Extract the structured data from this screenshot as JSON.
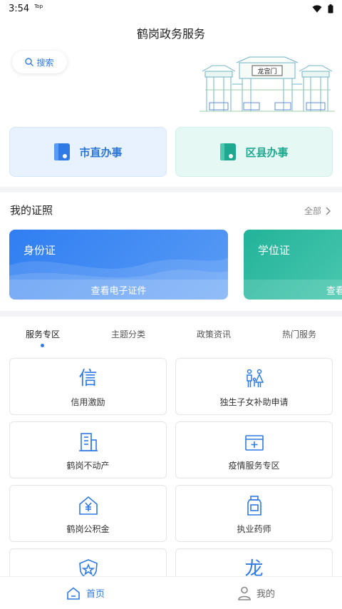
{
  "status_bar": {
    "time": "3:54",
    "tag": "Top"
  },
  "header": {
    "title": "鹤岗政务服务"
  },
  "search": {
    "label": "搜索"
  },
  "gate_art": {
    "sign_text": "龙宫门"
  },
  "offices": [
    {
      "label": "市直办事",
      "color": "#2b77d6"
    },
    {
      "label": "区县办事",
      "color": "#1ea88f"
    }
  ],
  "certificates": {
    "title": "我的证照",
    "all_label": "全部",
    "cards": [
      {
        "name": "身份证",
        "action": "查看电子证件"
      },
      {
        "name": "学位证",
        "action": "查看"
      }
    ]
  },
  "tabs": [
    "服务专区",
    "主题分类",
    "政策资讯",
    "热门服务"
  ],
  "active_tab": "服务专区",
  "services": [
    {
      "label": "信用激励",
      "icon": "credit-char-icon"
    },
    {
      "label": "独生子女补助申请",
      "icon": "family-icon"
    },
    {
      "label": "鹤岗不动产",
      "icon": "building-icon"
    },
    {
      "label": "疫情服务专区",
      "icon": "medical-box-icon"
    },
    {
      "label": "鹤岗公积金",
      "icon": "yuan-house-icon"
    },
    {
      "label": "执业药师",
      "icon": "medicine-bottle-icon"
    },
    {
      "label": "",
      "icon": "star-shield-icon"
    },
    {
      "label": "",
      "icon": "dragon-char-icon"
    }
  ],
  "icon_glyphs": {
    "credit": "信",
    "dragon": "龙"
  },
  "bottom_nav": [
    {
      "label": "首页",
      "icon": "home-icon",
      "active": true
    },
    {
      "label": "我的",
      "icon": "user-icon",
      "active": false
    }
  ],
  "colors": {
    "accent": "#2f7ae5",
    "teal": "#1ea88f",
    "band": "#f3f4f6"
  }
}
